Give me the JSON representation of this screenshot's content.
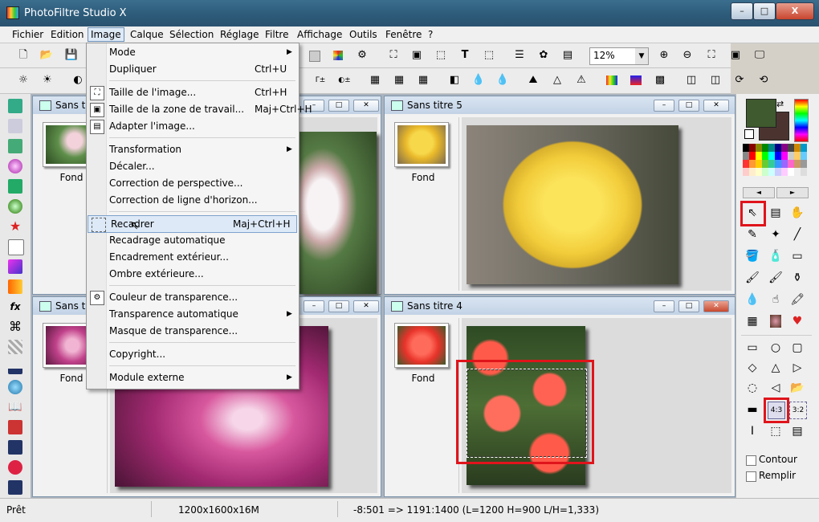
{
  "app": {
    "title": "PhotoFiltre Studio X"
  },
  "window_controls": {
    "minimize": "–",
    "maximize": "□",
    "close": "X"
  },
  "menubar": [
    "Fichier",
    "Edition",
    "Image",
    "Calque",
    "Sélection",
    "Réglage",
    "Filtre",
    "Affichage",
    "Outils",
    "Fenêtre",
    "?"
  ],
  "toolbar": {
    "zoom_value": "12%"
  },
  "image_menu": {
    "items": [
      {
        "label": "Mode",
        "shortcut": "",
        "submenu": true
      },
      {
        "label": "Dupliquer",
        "shortcut": "Ctrl+U",
        "submenu": false
      },
      {
        "label": "Taille de l'image...",
        "shortcut": "Ctrl+H",
        "submenu": false
      },
      {
        "label": "Taille de la zone de travail...",
        "shortcut": "Maj+Ctrl+H",
        "submenu": false
      },
      {
        "label": "Adapter l'image...",
        "shortcut": "",
        "submenu": false
      },
      {
        "label": "Transformation",
        "shortcut": "",
        "submenu": true
      },
      {
        "label": "Décaler...",
        "shortcut": "",
        "submenu": false
      },
      {
        "label": "Correction de perspective...",
        "shortcut": "",
        "submenu": false
      },
      {
        "label": "Correction de ligne d'horizon...",
        "shortcut": "",
        "submenu": false
      },
      {
        "label": "Recadrer",
        "shortcut": "Maj+Ctrl+H",
        "submenu": false
      },
      {
        "label": "Recadrage automatique",
        "shortcut": "",
        "submenu": false
      },
      {
        "label": "Encadrement extérieur...",
        "shortcut": "",
        "submenu": false
      },
      {
        "label": "Ombre extérieure...",
        "shortcut": "",
        "submenu": false
      },
      {
        "label": "Couleur de transparence...",
        "shortcut": "",
        "submenu": false
      },
      {
        "label": "Transparence automatique",
        "shortcut": "",
        "submenu": true
      },
      {
        "label": "Masque de transparence...",
        "shortcut": "",
        "submenu": false
      },
      {
        "label": "Copyright...",
        "shortcut": "",
        "submenu": false
      },
      {
        "label": "Module externe",
        "shortcut": "",
        "submenu": true
      }
    ],
    "highlighted": "Recadrer"
  },
  "windows": [
    {
      "title": "Sans tit",
      "layer": "Fond"
    },
    {
      "title": "Sans titre 5",
      "layer": "Fond"
    },
    {
      "title": "Sans tit",
      "layer": "Fond"
    },
    {
      "title": "Sans titre 4",
      "layer": "Fond"
    }
  ],
  "tool_panel": {
    "contour_label": "Contour",
    "remplir_label": "Remplir",
    "ratio_4_3": "4:3",
    "ratio_3_2": "3:2"
  },
  "statusbar": {
    "state": "Prêt",
    "image_info": "1200x1600x16M",
    "selection_info": "-8:501 => 1191:1400 (L=1200  H=900  L/H=1,333)"
  },
  "colors": {
    "foreground": "#3f5a2e",
    "background": "#4b3430",
    "highlight": "#e0141b"
  }
}
